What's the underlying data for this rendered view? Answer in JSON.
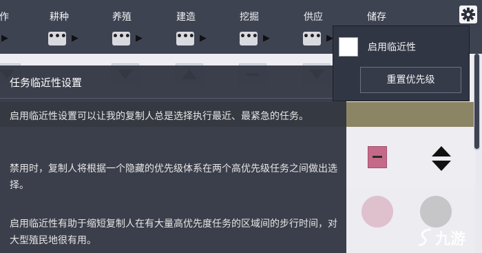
{
  "header": {
    "columns": [
      {
        "label": "作"
      },
      {
        "label": "耕种"
      },
      {
        "label": "养殖"
      },
      {
        "label": "建造"
      },
      {
        "label": "挖掘"
      },
      {
        "label": "供应"
      },
      {
        "label": "储存"
      }
    ],
    "more_label": "•••",
    "settings_icon": "gear-icon"
  },
  "tooltip": {
    "title": "任务临近性设置",
    "paragraphs": [
      "启用临近性设置可以让我的复制人总是选择执行最近、最紧急的任务。",
      "禁用时，复制人将根据一个隐藏的优先级体系在两个高优先级任务之间做出选择。",
      "启用临近性有助于缩短复制人在有大量高优先度任务的区域间的步行时间，对大型殖民地很有用。"
    ]
  },
  "dropdown": {
    "proximity_label": "启用临近性",
    "proximity_checked": false,
    "reset_label": "重置优先级"
  },
  "watermark": {
    "text": "九游"
  },
  "colors": {
    "header_bg": "#3e4352",
    "tooltip_bg": "#303440",
    "accent_pink": "#c46a88",
    "divider_row": "#8c8565"
  }
}
